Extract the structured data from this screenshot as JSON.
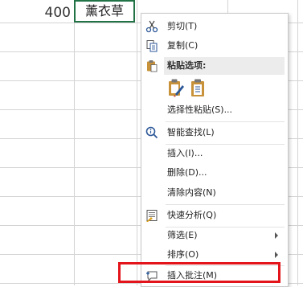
{
  "sheet": {
    "cells": {
      "number_value": "400",
      "active_cell_value": "薰衣草"
    },
    "colors": {
      "grid_line": "#d4d4d4",
      "active_cell_border": "#217346",
      "highlight_border": "#e3151a"
    }
  },
  "context_menu": {
    "cut": "剪切(T)",
    "copy": "复制(C)",
    "paste_options_header": "粘贴选项:",
    "paste_special": "选择性粘贴(S)...",
    "smart_lookup": "智能查找(L)",
    "insert": "插入(I)...",
    "delete": "删除(D)...",
    "clear_contents": "清除内容(N)",
    "quick_analysis": "快速分析(Q)",
    "filter": "筛选(E)",
    "sort": "排序(O)",
    "insert_comment": "插入批注(M)"
  }
}
